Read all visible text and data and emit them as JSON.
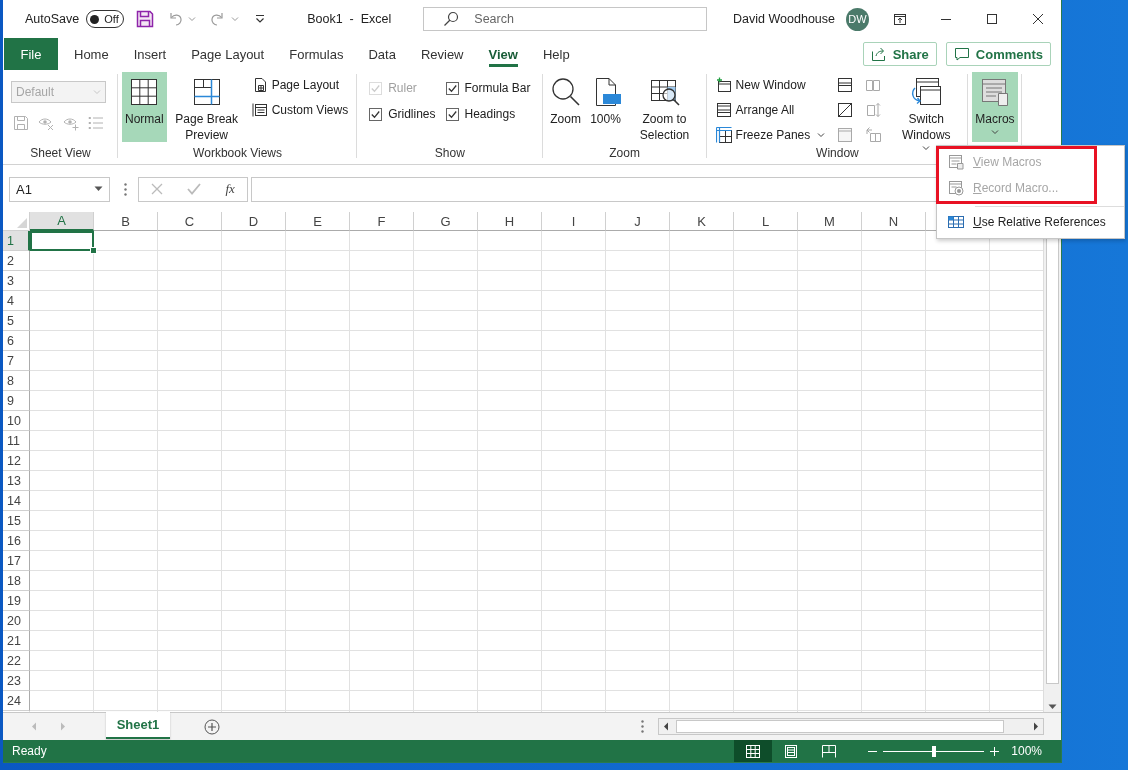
{
  "title_bar": {
    "autosave": {
      "label": "AutoSave",
      "on": false,
      "state_text": "Off"
    },
    "document_title": "Book1  -  Excel",
    "search": {
      "placeholder": "Search"
    },
    "user_name": "David Woodhouse",
    "avatar_initials": "DW"
  },
  "menu_tabs": [
    {
      "label": "File",
      "kind": "file",
      "selected": false
    },
    {
      "label": "Home",
      "kind": "tab",
      "selected": false
    },
    {
      "label": "Insert",
      "kind": "tab",
      "selected": false
    },
    {
      "label": "Page Layout",
      "kind": "tab",
      "selected": false
    },
    {
      "label": "Formulas",
      "kind": "tab",
      "selected": false
    },
    {
      "label": "Data",
      "kind": "tab",
      "selected": false
    },
    {
      "label": "Review",
      "kind": "tab",
      "selected": false
    },
    {
      "label": "View",
      "kind": "tab",
      "selected": true
    },
    {
      "label": "Help",
      "kind": "tab",
      "selected": false
    }
  ],
  "header_buttons": [
    {
      "label": "Share",
      "kind": "share"
    },
    {
      "label": "Comments",
      "kind": "comments"
    }
  ],
  "ribbon": {
    "groups": [
      {
        "name": "Sheet View",
        "kind": "sheet_view",
        "dropdown": {
          "value": "Default",
          "disabled": true
        }
      },
      {
        "name": "Workbook Views",
        "kind": "buttons",
        "items": [
          {
            "label": "Normal",
            "kind": "normal",
            "selected": true
          },
          {
            "label": "Page Break Preview",
            "kind": "page_break",
            "selected": false
          },
          {
            "label": "Page Layout",
            "kind": "page_layout",
            "selected": false
          },
          {
            "label": "Custom Views",
            "kind": "custom_views",
            "selected": false
          }
        ]
      },
      {
        "name": "Show",
        "kind": "checkboxes",
        "items": [
          {
            "label": "Ruler",
            "checked": true,
            "disabled": true
          },
          {
            "label": "Formula Bar",
            "checked": true,
            "disabled": false
          },
          {
            "label": "Gridlines",
            "checked": true,
            "disabled": false
          },
          {
            "label": "Headings",
            "checked": true,
            "disabled": false
          }
        ]
      },
      {
        "name": "Zoom",
        "kind": "buttons",
        "items": [
          {
            "label": "Zoom",
            "kind": "zoom"
          },
          {
            "label": "100%",
            "kind": "zoom_100"
          },
          {
            "label": "Zoom to Selection",
            "kind": "zoom_selection"
          }
        ]
      },
      {
        "name": "Window",
        "kind": "buttons",
        "items": [
          {
            "label": "New Window",
            "kind": "new_window",
            "disabled": false
          },
          {
            "label": "Arrange All",
            "kind": "arrange_all",
            "disabled": false
          },
          {
            "label": "Freeze Panes",
            "kind": "freeze_panes",
            "dropdown": true,
            "disabled": false
          },
          {
            "kind": "split",
            "disabled": false
          },
          {
            "kind": "hide",
            "disabled": false
          },
          {
            "kind": "unhide",
            "disabled": true
          },
          {
            "kind": "side_by_side",
            "disabled": true
          },
          {
            "kind": "sync_scroll",
            "disabled": true
          },
          {
            "kind": "reset_position",
            "disabled": true
          },
          {
            "label": "Switch Windows",
            "kind": "switch_windows",
            "dropdown": true,
            "disabled": false
          }
        ]
      },
      {
        "kind": "buttons",
        "items": [
          {
            "label": "Macros",
            "kind": "macros",
            "dropdown": true,
            "expanded": true
          }
        ]
      }
    ]
  },
  "formula_bar": {
    "name_box": "A1",
    "function_label": "fx"
  },
  "grid": {
    "columns": [
      {
        "label": "A",
        "selected": true
      },
      {
        "label": "B",
        "selected": false
      },
      {
        "label": "C",
        "selected": false
      },
      {
        "label": "D",
        "selected": false
      },
      {
        "label": "E",
        "selected": false
      },
      {
        "label": "F",
        "selected": false
      },
      {
        "label": "G",
        "selected": false
      },
      {
        "label": "H",
        "selected": false
      },
      {
        "label": "I",
        "selected": false
      },
      {
        "label": "J",
        "selected": false
      },
      {
        "label": "K",
        "selected": false
      },
      {
        "label": "L",
        "selected": false
      },
      {
        "label": "M",
        "selected": false
      },
      {
        "label": "N",
        "selected": false
      }
    ],
    "rows": [
      {
        "label": "1",
        "selected": true
      },
      {
        "label": "2",
        "selected": false
      },
      {
        "label": "3",
        "selected": false
      },
      {
        "label": "4",
        "selected": false
      },
      {
        "label": "5",
        "selected": false
      },
      {
        "label": "6",
        "selected": false
      },
      {
        "label": "7",
        "selected": false
      },
      {
        "label": "8",
        "selected": false
      },
      {
        "label": "9",
        "selected": false
      },
      {
        "label": "10",
        "selected": false
      },
      {
        "label": "11",
        "selected": false
      },
      {
        "label": "12",
        "selected": false
      },
      {
        "label": "13",
        "selected": false
      },
      {
        "label": "14",
        "selected": false
      },
      {
        "label": "15",
        "selected": false
      },
      {
        "label": "16",
        "selected": false
      },
      {
        "label": "17",
        "selected": false
      },
      {
        "label": "18",
        "selected": false
      },
      {
        "label": "19",
        "selected": false
      },
      {
        "label": "20",
        "selected": false
      },
      {
        "label": "21",
        "selected": false
      },
      {
        "label": "22",
        "selected": false
      },
      {
        "label": "23",
        "selected": false
      },
      {
        "label": "24",
        "selected": false
      }
    ]
  },
  "sheet_tabs": [
    {
      "label": "Sheet1",
      "selected": true
    }
  ],
  "status_bar": {
    "status": "Ready",
    "view_buttons": [
      {
        "kind": "normal",
        "selected": true
      },
      {
        "kind": "page_layout",
        "selected": false
      },
      {
        "kind": "page_break",
        "selected": false
      }
    ],
    "zoom": {
      "level": 0.5,
      "reading": "100%"
    }
  },
  "macros_menu": {
    "items": [
      {
        "label": "View Macros",
        "kind": "view_macros",
        "disabled": true,
        "highlighted": true,
        "separator_before": false
      },
      {
        "label": "Record Macro...",
        "kind": "record_macro",
        "disabled": true,
        "highlighted": true,
        "separator_before": false
      },
      {
        "label": "Use Relative References",
        "kind": "relative_refs",
        "disabled": false,
        "highlighted": false,
        "separator_before": true
      }
    ]
  }
}
